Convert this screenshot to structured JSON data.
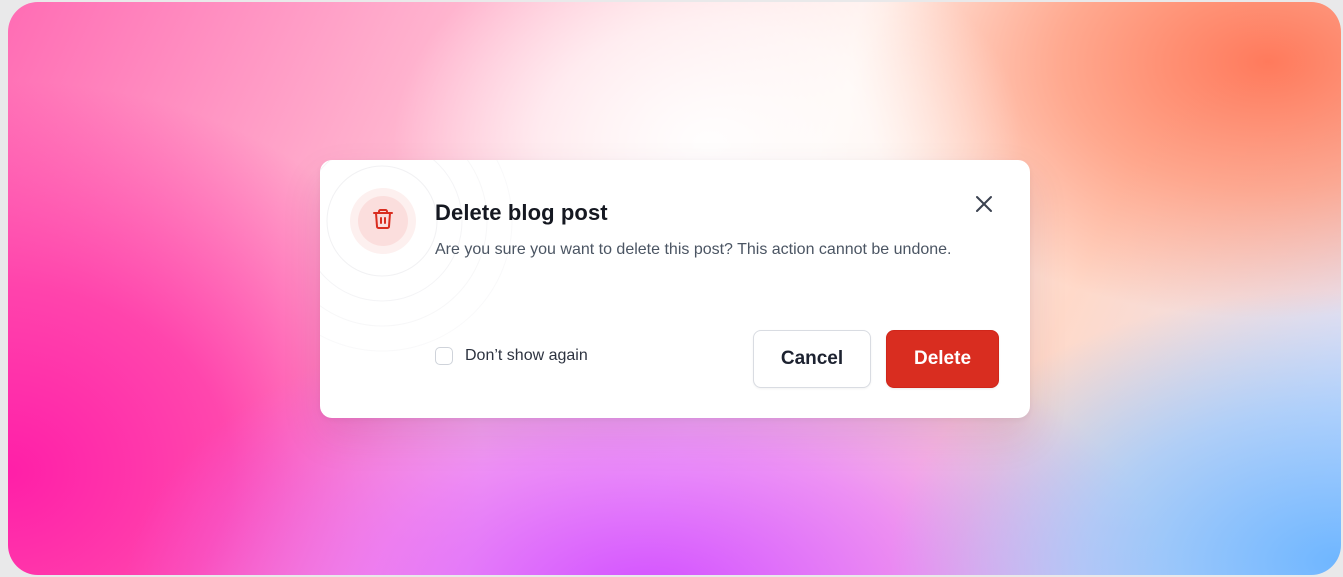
{
  "dialog": {
    "title": "Delete blog post",
    "message": "Are you sure you want to delete this post? This action cannot be undone.",
    "icon": "trash-icon",
    "close_icon": "close-icon",
    "checkbox": {
      "label": "Don’t show again",
      "checked": false
    },
    "cancel_label": "Cancel",
    "delete_label": "Delete"
  },
  "colors": {
    "danger": "#d92d20",
    "danger_icon_bg": "#fbdedd",
    "title_text": "#151821",
    "body_text": "#4b5563"
  }
}
